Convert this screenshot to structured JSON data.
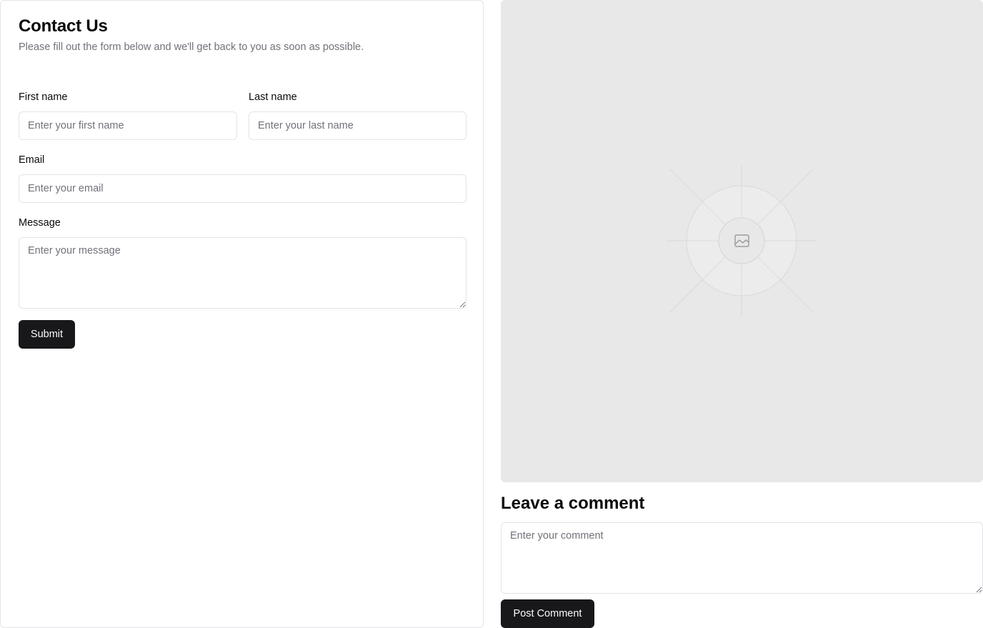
{
  "contact": {
    "title": "Contact Us",
    "description": "Please fill out the form below and we'll get back to you as soon as possible.",
    "first_name": {
      "label": "First name",
      "placeholder": "Enter your first name",
      "value": ""
    },
    "last_name": {
      "label": "Last name",
      "placeholder": "Enter your last name",
      "value": ""
    },
    "email": {
      "label": "Email",
      "placeholder": "Enter your email",
      "value": ""
    },
    "message": {
      "label": "Message",
      "placeholder": "Enter your message",
      "value": ""
    },
    "submit_label": "Submit"
  },
  "image": {
    "icon": "image-icon"
  },
  "comment": {
    "title": "Leave a comment",
    "placeholder": "Enter your comment",
    "value": "",
    "post_label": "Post Comment"
  },
  "colors": {
    "primary": "#18181b",
    "border": "#e4e4e7",
    "muted_text": "#71717a",
    "placeholder_bg": "#e8e8e8"
  }
}
